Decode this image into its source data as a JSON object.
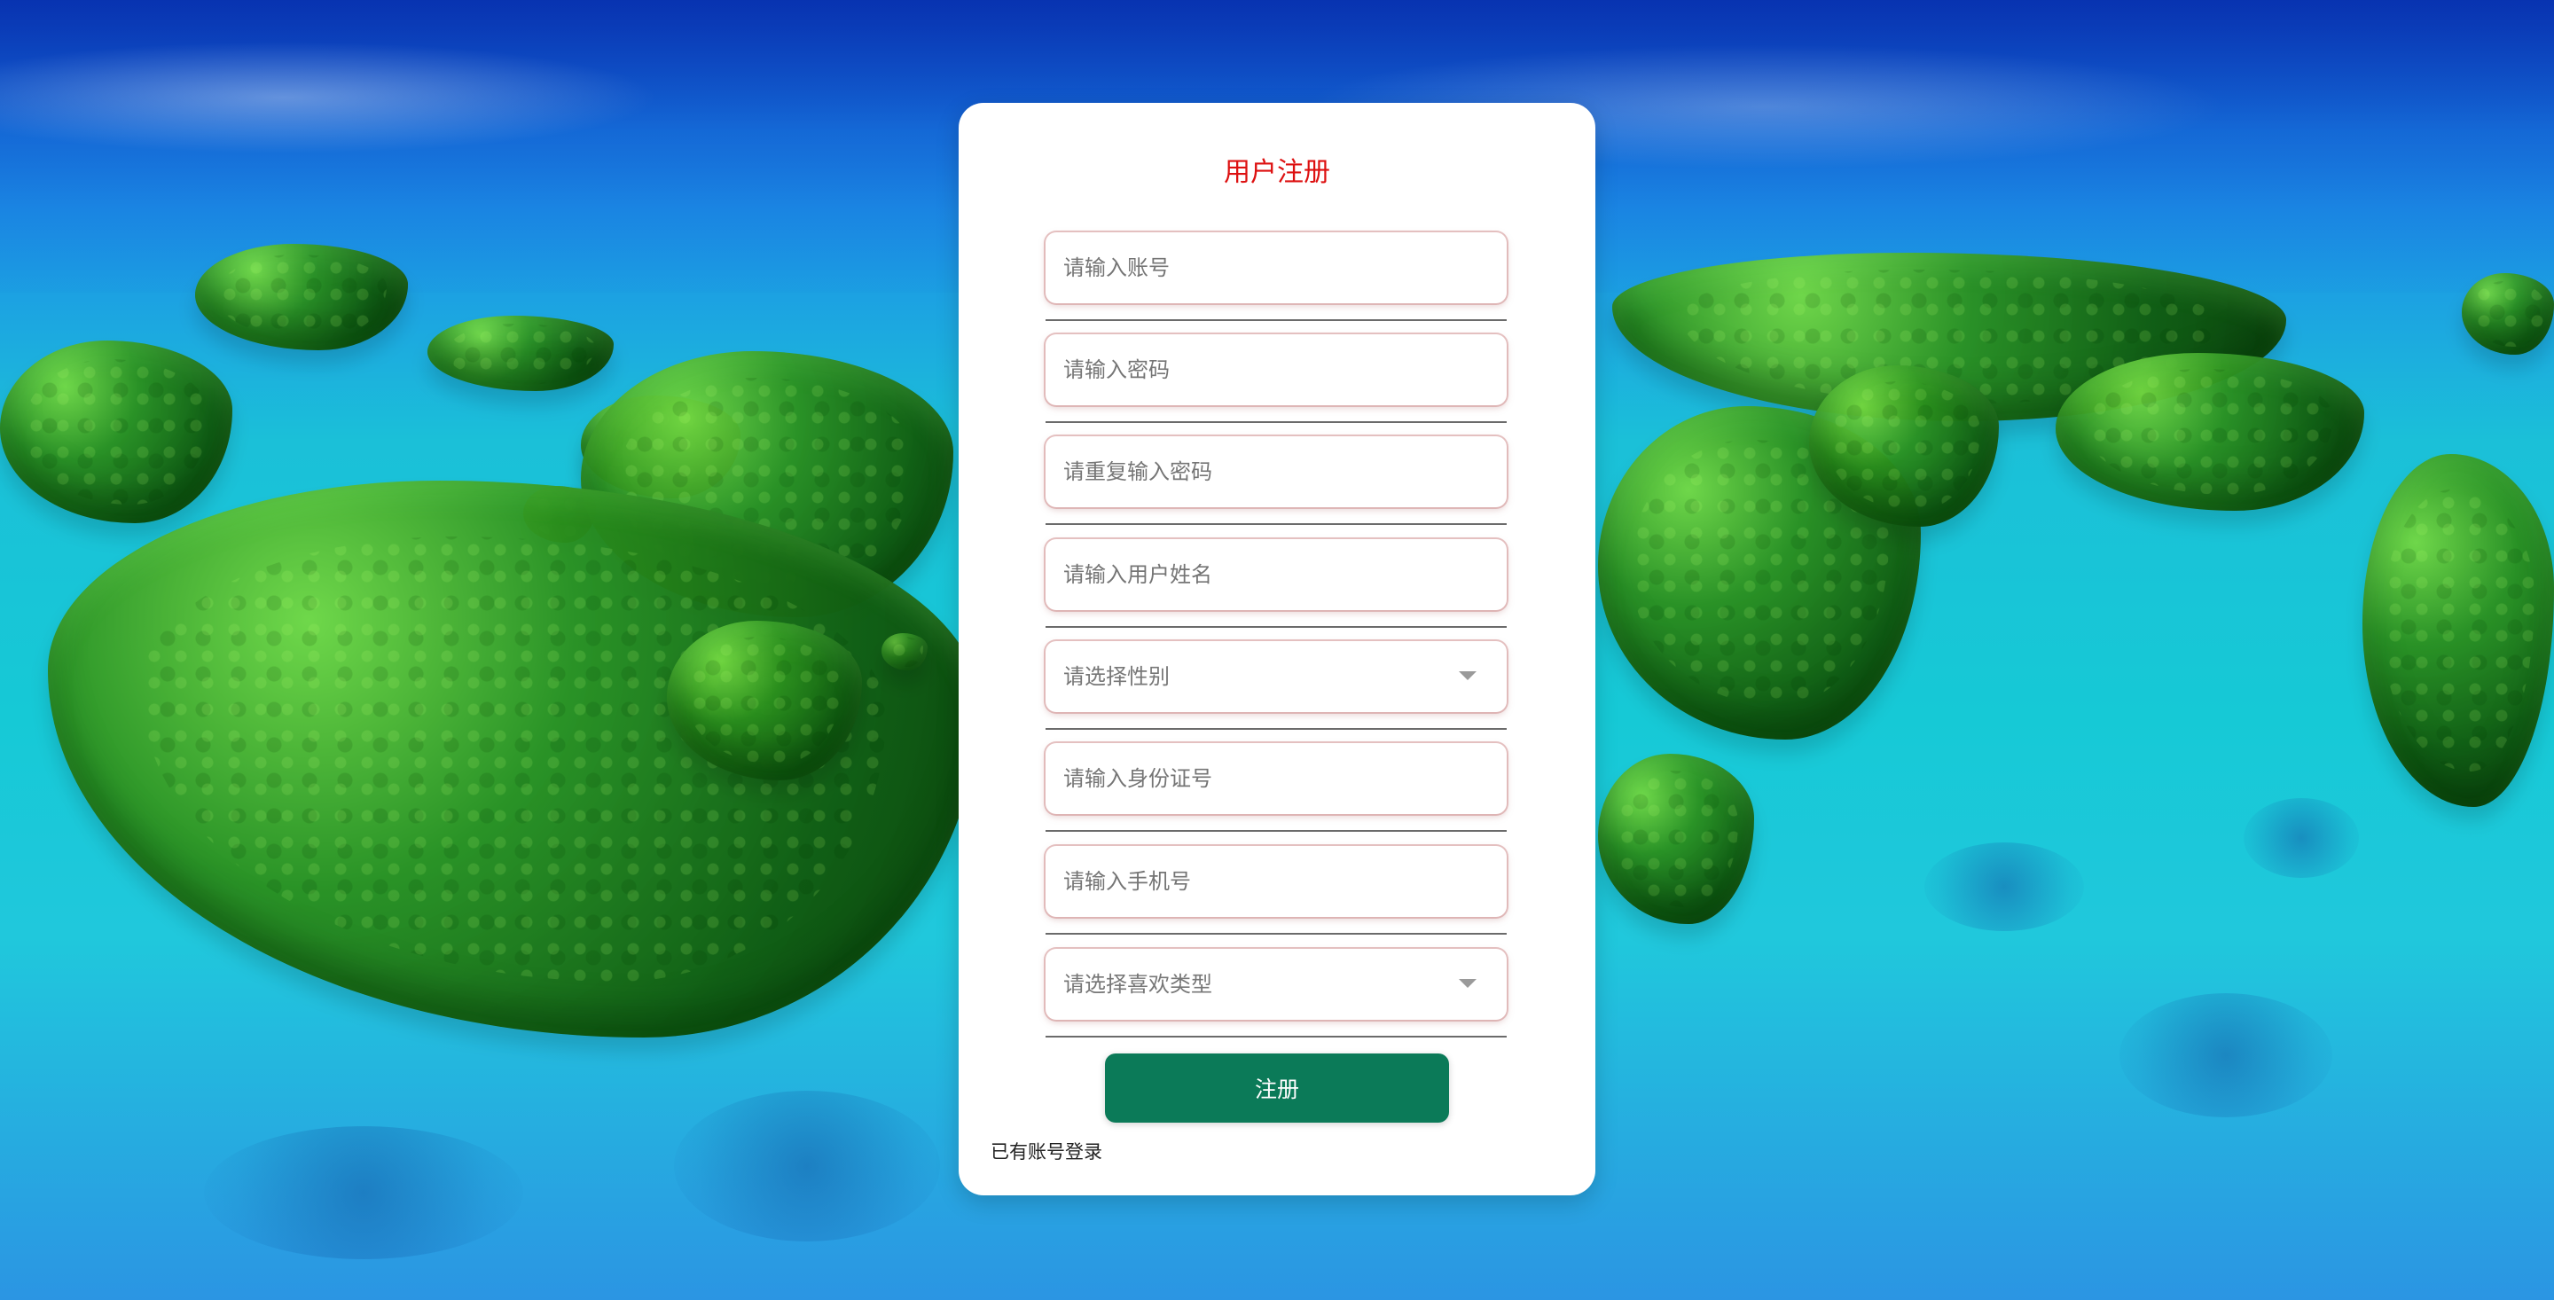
{
  "form": {
    "title": "用户注册",
    "fields": [
      {
        "placeholder": "请输入账号",
        "value": ""
      },
      {
        "placeholder": "请输入密码",
        "value": ""
      },
      {
        "placeholder": "请重复输入密码",
        "value": ""
      },
      {
        "placeholder": "请输入用户姓名",
        "value": ""
      },
      {
        "selected": "请选择性别"
      },
      {
        "placeholder": "请输入身份证号",
        "value": ""
      },
      {
        "placeholder": "请输入手机号",
        "value": ""
      },
      {
        "selected": "请选择喜欢类型"
      }
    ],
    "register_label": "注册",
    "login_link_label": "已有账号登录"
  },
  "icons": {
    "dropdown": "chevron-down-icon"
  },
  "colors": {
    "title": "#dd1010",
    "button": "#0b7a58",
    "card": "#ffffff"
  }
}
